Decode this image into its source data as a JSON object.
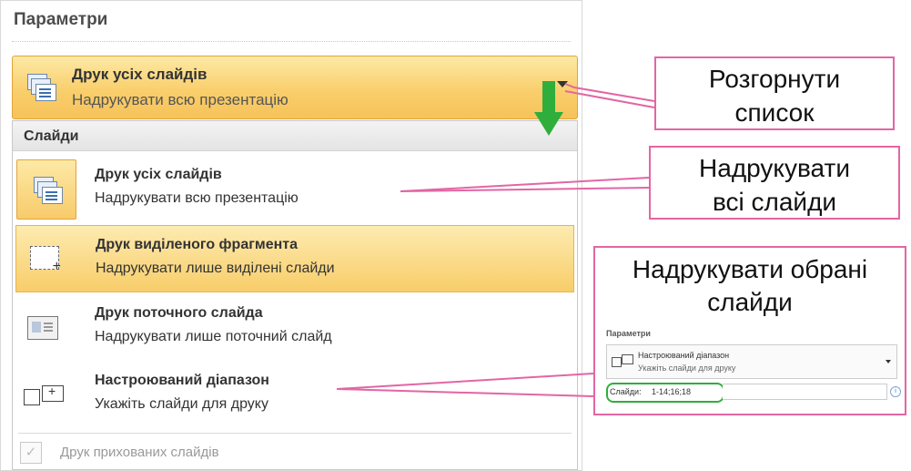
{
  "params": {
    "title": "Параметри"
  },
  "selected": {
    "title": "Друк усіх слайдів",
    "subtitle": "Надрукувати всю презентацію"
  },
  "menu": {
    "section": "Слайди",
    "items": [
      {
        "title": "Друк усіх слайдів",
        "subtitle": "Надрукувати всю презентацію"
      },
      {
        "title": "Друк виділеного фрагмента",
        "subtitle": "Надрукувати лише виділені слайди"
      },
      {
        "title": "Друк поточного слайда",
        "subtitle": "Надрукувати лише поточний слайд"
      },
      {
        "title": "Настроюваний діапазон",
        "subtitle": "Укажіть слайди для друку"
      }
    ],
    "hidden_slides": "Друк прихованих слайдів"
  },
  "callouts": {
    "expand": {
      "line1": "Розгорнути",
      "line2": "список"
    },
    "print_all": {
      "line1": "Надрукувати",
      "line2": "всі слайди"
    },
    "print_selected": {
      "line1": "Надрукувати обрані",
      "line2": "слайди"
    }
  },
  "mini": {
    "title": "Параметри",
    "dropdown_title": "Настроюваний діапазон",
    "dropdown_subtitle": "Укажіть слайди для друку",
    "slides_label": "Слайди:",
    "slides_value": "1-14;16;18"
  },
  "colors": {
    "highlight": "#f9cf6c",
    "callout_border": "#e266a4",
    "green_arrow": "#2fae3c",
    "mini_highlight": "#2fae3c"
  }
}
